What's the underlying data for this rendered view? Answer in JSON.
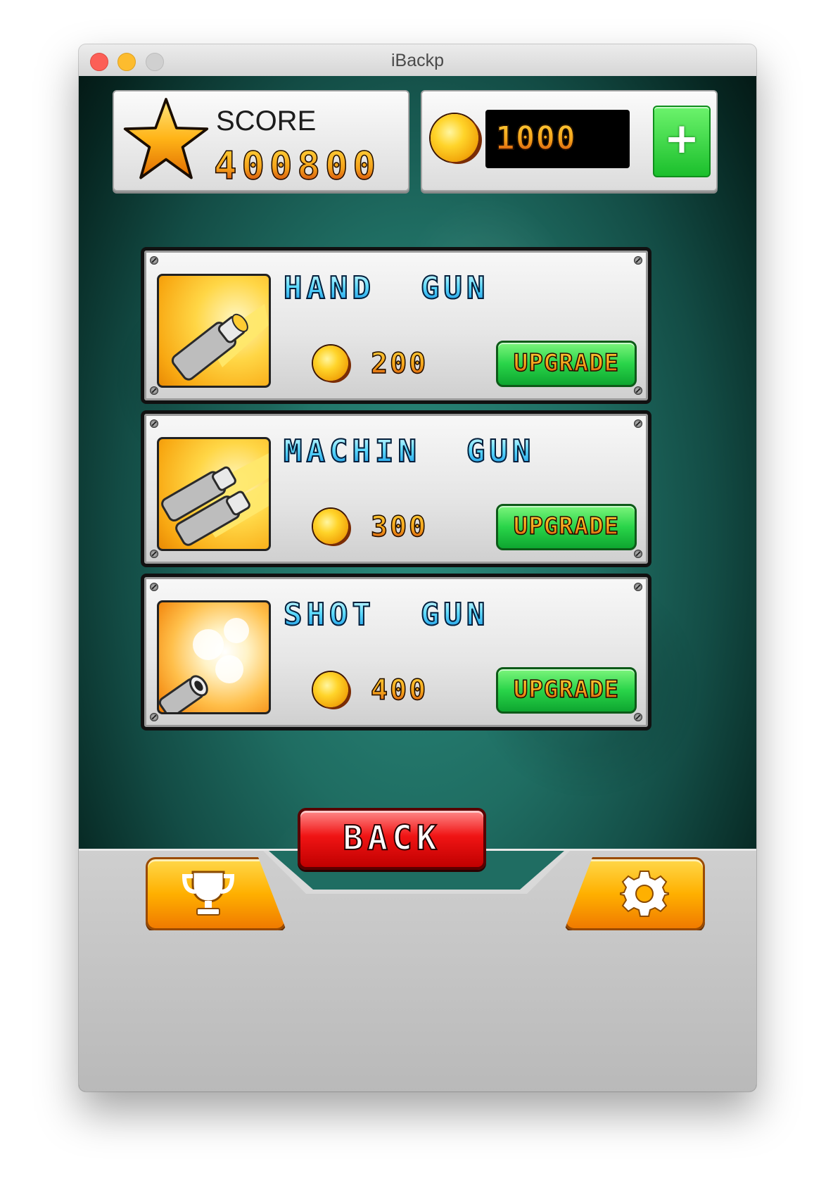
{
  "window": {
    "title": "iBackp"
  },
  "hud": {
    "score_label": "SCORE",
    "score_value": "400800",
    "coins_value": "1000",
    "add_coins_icon": "plus-icon"
  },
  "items": [
    {
      "name": "HAND  GUN",
      "price": "200",
      "button": "UPGRADE",
      "icon": "handgun-icon"
    },
    {
      "name": "MACHIN  GUN",
      "price": "300",
      "button": "UPGRADE",
      "icon": "machinegun-icon"
    },
    {
      "name": "SHOT  GUN",
      "price": "400",
      "button": "UPGRADE",
      "icon": "shotgun-icon"
    }
  ],
  "back_label": "BACK",
  "footer": {
    "left_icon": "trophy-icon",
    "right_icon": "gear-icon"
  },
  "colors": {
    "background": "#1f6d62",
    "upgrade_green": "#29d449",
    "back_red": "#f01414",
    "footer_orange": "#ffb000"
  }
}
